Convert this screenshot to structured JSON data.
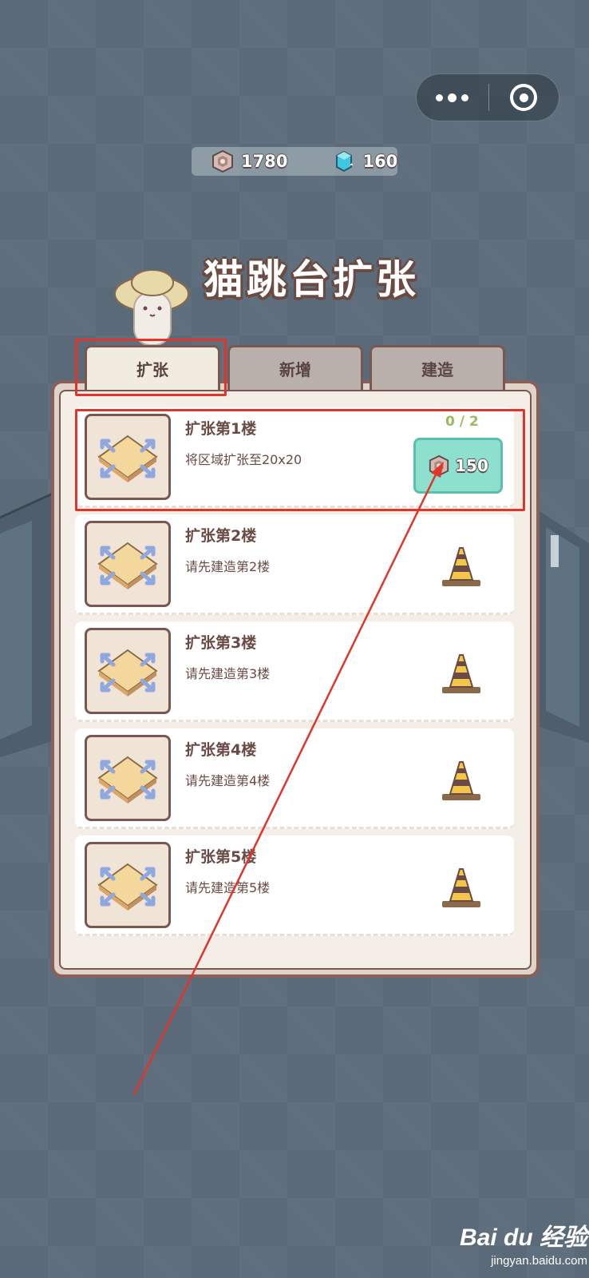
{
  "capsule": {
    "more_icon": "more-dots-icon",
    "close_icon": "target-close-icon"
  },
  "currency": {
    "coins": {
      "icon": "coin-icon",
      "value": "1780"
    },
    "gems": {
      "icon": "gem-icon",
      "value": "160"
    }
  },
  "title": "猫跳台扩张",
  "tabs": [
    {
      "label": "扩张",
      "active": true
    },
    {
      "label": "新增",
      "active": false
    },
    {
      "label": "建造",
      "active": false
    }
  ],
  "rows": [
    {
      "title": "扩张第1楼",
      "desc": "将区域扩张至20x20",
      "progress": "0 / 2",
      "cost": "150",
      "state": "buy"
    },
    {
      "title": "扩张第2楼",
      "desc": "请先建造第2楼",
      "state": "locked"
    },
    {
      "title": "扩张第3楼",
      "desc": "请先建造第3楼",
      "state": "locked"
    },
    {
      "title": "扩张第4楼",
      "desc": "请先建造第4楼",
      "state": "locked"
    },
    {
      "title": "扩张第5楼",
      "desc": "请先建造第5楼",
      "state": "locked"
    }
  ],
  "colors": {
    "highlight": "#e0352b",
    "buy_button": "#8de0cd",
    "panel_border": "#8a5f5a"
  },
  "watermark": {
    "logo": "Bai du 经验",
    "site": "jingyan.baidu.com"
  }
}
